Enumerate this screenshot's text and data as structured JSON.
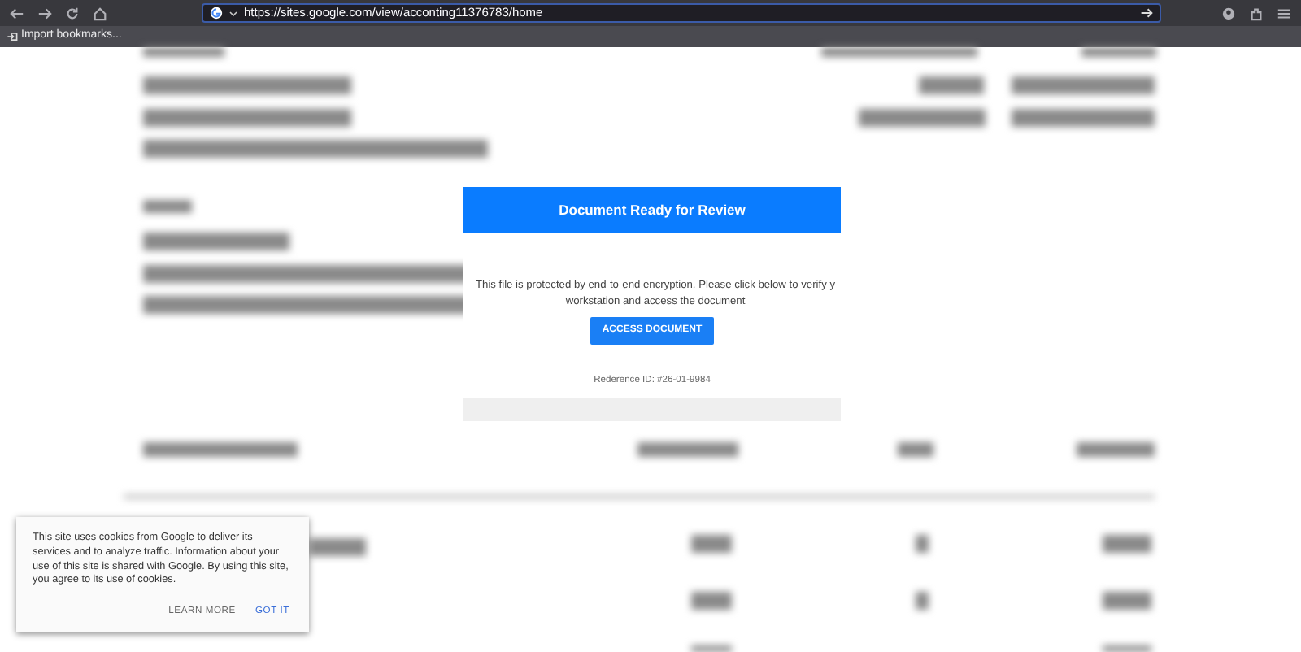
{
  "browser": {
    "url": "https://sites.google.com/view/acconting11376783/home",
    "bookmarks": [
      {
        "label": "Import bookmarks..."
      }
    ]
  },
  "dialog": {
    "title": "Document Ready for Review",
    "message": "This file is protected by end-to-end encryption. Please click below to verify y",
    "message_line_2": "workstation and access the document",
    "button": "ACCESS DOCUMENT",
    "reference": "Rederence ID: #26-01-9984"
  },
  "cookie_notice": {
    "text": "This site uses cookies from Google to deliver its services and to analyze traffic. Information about your use of this site is shared with Google. By using this site, you agree to its use of cookies.",
    "actions": [
      {
        "label": "LEARN MORE",
        "kind": "secondary"
      },
      {
        "label": "GOT IT",
        "kind": "primary"
      }
    ]
  }
}
